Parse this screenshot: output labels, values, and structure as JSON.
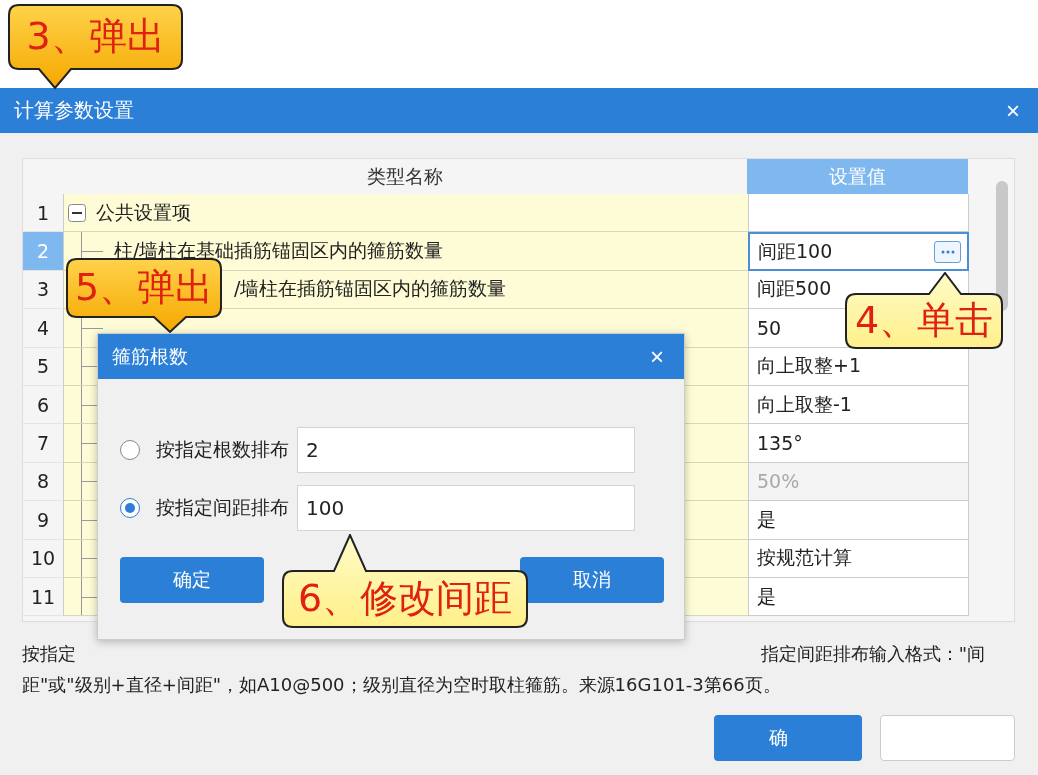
{
  "window": {
    "title": "计算参数设置",
    "close": "×"
  },
  "table": {
    "columns": [
      "类型名称",
      "设置值"
    ],
    "rows": [
      {
        "num": "1",
        "kind": "group",
        "expanded": true,
        "name": "公共设置项",
        "selected": false
      },
      {
        "num": "2",
        "kind": "item",
        "name": "柱/墙柱在基础插筋锚固区内的箍筋数量",
        "value": "间距100",
        "selected": true,
        "disabled": false
      },
      {
        "num": "3",
        "kind": "item",
        "name": "/墙柱在插筋锚固区内的箍筋数量",
        "value": "间距500",
        "selected": false,
        "disabled": false
      },
      {
        "num": "4",
        "kind": "item",
        "value": "50",
        "selected": false,
        "disabled": false
      },
      {
        "num": "5",
        "kind": "item",
        "value": "向上取整+1",
        "selected": false,
        "disabled": false
      },
      {
        "num": "6",
        "kind": "item",
        "value": "向上取整-1",
        "selected": false,
        "disabled": false
      },
      {
        "num": "7",
        "kind": "item",
        "value": "135°",
        "selected": false,
        "disabled": false
      },
      {
        "num": "8",
        "kind": "item",
        "value": "50%",
        "selected": false,
        "disabled": true
      },
      {
        "num": "9",
        "kind": "item",
        "value": "是",
        "selected": false,
        "disabled": false
      },
      {
        "num": "10",
        "kind": "item",
        "value": "按规范计算",
        "selected": false,
        "disabled": false
      },
      {
        "num": "11",
        "kind": "item",
        "value": "是",
        "selected": false,
        "disabled": false
      }
    ]
  },
  "description": {
    "line_1_start": "按指定",
    "line_1_end": "指定间距排布输入格式：\"间",
    "line_2": "距\"或\"级别+直径+间距\"，如A10@500；级别直径为空时取柱箍筋。来源16G101-3第66页。"
  },
  "footer_buttons": [
    {
      "kind": "primary",
      "label": "确"
    },
    {
      "kind": "secondary"
    }
  ],
  "dialog": {
    "title": "箍筋根数",
    "close": "×",
    "options": [
      {
        "label": "按指定根数排布",
        "value": "2",
        "selected": false
      },
      {
        "label": "按指定间距排布",
        "value": "100",
        "selected": true
      }
    ],
    "buttons": [
      "确定",
      "取消"
    ]
  },
  "callouts": [
    {
      "text": "3、弹出",
      "kind": "orange"
    },
    {
      "text": "5、弹出",
      "kind": "orange"
    },
    {
      "text": "4、单击",
      "kind": "pale"
    },
    {
      "text": "6、修改间距",
      "kind": "pale"
    }
  ]
}
